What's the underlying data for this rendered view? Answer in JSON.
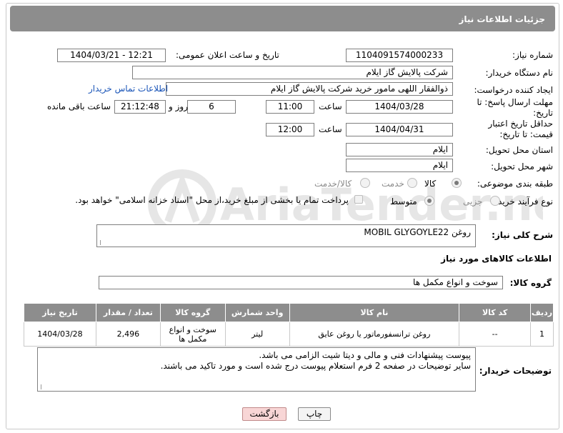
{
  "header": {
    "title": "جزئیات اطلاعات نیاز"
  },
  "fields": {
    "need_number_label": "شماره نیاز:",
    "need_number": "1104091574000233",
    "announce_label": "تاریخ و ساعت اعلان عمومی:",
    "announce_value": "1404/03/21 - 12:21",
    "buyer_org_label": "نام دستگاه خریدار:",
    "buyer_org": "شرکت پالایش گاز ایلام",
    "creator_label": "ایجاد کننده درخواست:",
    "creator": "ذوالفقار اللهی مامور خرید شرکت پالایش گاز ایلام",
    "contact_link": "اطلاعات تماس خریدار",
    "deadline_label": "مهلت ارسال پاسخ: تا تاریخ:",
    "deadline_date": "1404/03/28",
    "time_label": "ساعت",
    "deadline_time": "11:00",
    "days_value": "6",
    "days_label": "روز و",
    "remaining_time": "21:12:48",
    "remaining_label": "ساعت باقی مانده",
    "validity_label": "حداقل تاریخ اعتبار قیمت: تا تاریخ:",
    "validity_date": "1404/04/31",
    "validity_time": "12:00",
    "province_label": "استان محل تحویل:",
    "province": "ایلام",
    "city_label": "شهر محل تحویل:",
    "city": "ایلام",
    "category_label": "طبقه بندی موضوعی:",
    "category_options": [
      "کالا",
      "خدمت",
      "کالا/خدمت"
    ],
    "process_label": "نوع فرآیند خرید :",
    "process_options": [
      "جزیی",
      "متوسط"
    ],
    "process_note": "پرداخت تمام یا بخشی از مبلغ خرید،از محل \"اسناد خزانه اسلامی\" خواهد بود.",
    "description_label": "شرح کلی نیاز:",
    "description": "روغن MOBIL GLYGOYLE22",
    "goods_info_title": "اطلاعات کالاهای مورد نیاز",
    "goods_group_label": "گروه کالا:",
    "goods_group": "سوخت و انواع مکمل ها",
    "buyer_notes_label": "توضیحات خریدار:",
    "buyer_notes_line1": "پیوست پیشنهادات فنی و مالی و دیتا شیت الزامی می باشد.",
    "buyer_notes_line2": "سایر توضیحات در صفحه 2 فرم استعلام پیوست درج شده است و مورد تاکید می باشند."
  },
  "table": {
    "headers": [
      "ردیف",
      "کد کالا",
      "نام کالا",
      "واحد شمارش",
      "گروه کالا",
      "تعداد / مقدار",
      "تاریخ نیاز"
    ],
    "rows": [
      [
        "1",
        "--",
        "روغن ترانسفورماتور یا روغن عایق",
        "لیتر",
        "سوخت و انواع مکمل ها",
        "2,496",
        "1404/03/28"
      ]
    ]
  },
  "buttons": {
    "print": "چاپ",
    "back": "بازگشت"
  },
  "watermark": {
    "text": "AriaTender.net"
  },
  "colors": {
    "header_bg": "#8d8d8d",
    "back_button": "#f8d6d6",
    "link": "#1a55b8"
  }
}
